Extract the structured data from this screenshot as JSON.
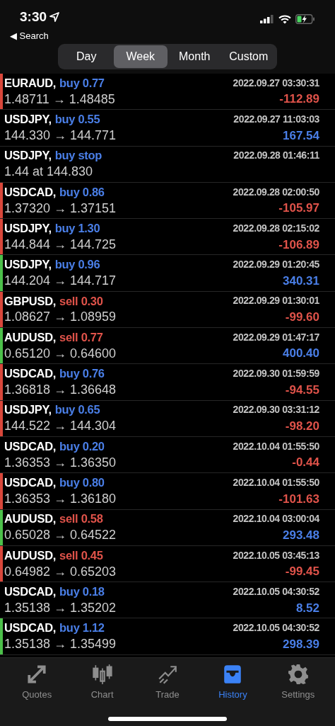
{
  "status_bar": {
    "time": "3:30",
    "back": "◀ Search"
  },
  "periods": [
    {
      "label": "Day",
      "selected": false
    },
    {
      "label": "Week",
      "selected": true
    },
    {
      "label": "Month",
      "selected": false
    },
    {
      "label": "Custom",
      "selected": false
    }
  ],
  "deals": [
    {
      "symbol": "EURAUD,",
      "order": {
        "text": "buy 0.77",
        "color": "#4a7fe8"
      },
      "prices": "1.48711 → 1.48485",
      "time": "2022.09.27 03:30:31",
      "profit": {
        "text": "-112.89",
        "color": "#e0534a"
      },
      "marker": {
        "color": "#d9473b"
      }
    },
    {
      "symbol": "USDJPY,",
      "order": {
        "text": "buy 0.55",
        "color": "#4a7fe8"
      },
      "prices": "144.330 → 144.771",
      "time": "2022.09.27 11:03:03",
      "profit": {
        "text": "167.54",
        "color": "#4a7fe8"
      }
    },
    {
      "symbol": "USDJPY,",
      "order": {
        "text": "buy stop",
        "color": "#4a7fe8"
      },
      "prices": "1.44 at 144.830",
      "time": "2022.09.28 01:46:11"
    },
    {
      "symbol": "USDCAD,",
      "order": {
        "text": "buy 0.86",
        "color": "#4a7fe8"
      },
      "prices": "1.37320 → 1.37151",
      "time": "2022.09.28 02:00:50",
      "profit": {
        "text": "-105.97",
        "color": "#e0534a"
      },
      "marker": {
        "color": "#d9473b"
      }
    },
    {
      "symbol": "USDJPY,",
      "order": {
        "text": "buy 1.30",
        "color": "#4a7fe8"
      },
      "prices": "144.844 → 144.725",
      "time": "2022.09.28 02:15:02",
      "profit": {
        "text": "-106.89",
        "color": "#e0534a"
      },
      "marker": {
        "color": "#d9473b"
      }
    },
    {
      "symbol": "USDJPY,",
      "order": {
        "text": "buy 0.96",
        "color": "#4a7fe8"
      },
      "prices": "144.204 → 144.717",
      "time": "2022.09.29 01:20:45",
      "profit": {
        "text": "340.31",
        "color": "#4a7fe8"
      },
      "marker": {
        "color": "#4cc04a"
      }
    },
    {
      "symbol": "GBPUSD,",
      "order": {
        "text": "sell 0.30",
        "color": "#e0534a"
      },
      "prices": "1.08627 → 1.08959",
      "time": "2022.09.29 01:30:01",
      "profit": {
        "text": "-99.60",
        "color": "#e0534a"
      },
      "marker": {
        "color": "#d9473b"
      }
    },
    {
      "symbol": "AUDUSD,",
      "order": {
        "text": "sell 0.77",
        "color": "#e0534a"
      },
      "prices": "0.65120 → 0.64600",
      "time": "2022.09.29 01:47:17",
      "profit": {
        "text": "400.40",
        "color": "#4a7fe8"
      },
      "marker": {
        "color": "#4cc04a"
      }
    },
    {
      "symbol": "USDCAD,",
      "order": {
        "text": "buy 0.76",
        "color": "#4a7fe8"
      },
      "prices": "1.36818 → 1.36648",
      "time": "2022.09.30 01:59:59",
      "profit": {
        "text": "-94.55",
        "color": "#e0534a"
      },
      "marker": {
        "color": "#d9473b"
      }
    },
    {
      "symbol": "USDJPY,",
      "order": {
        "text": "buy 0.65",
        "color": "#4a7fe8"
      },
      "prices": "144.522 → 144.304",
      "time": "2022.09.30 03:31:12",
      "profit": {
        "text": "-98.20",
        "color": "#e0534a"
      },
      "marker": {
        "color": "#d9473b"
      }
    },
    {
      "symbol": "USDCAD,",
      "order": {
        "text": "buy 0.20",
        "color": "#4a7fe8"
      },
      "prices": "1.36353 → 1.36350",
      "time": "2022.10.04 01:55:50",
      "profit": {
        "text": "-0.44",
        "color": "#e0534a"
      }
    },
    {
      "symbol": "USDCAD,",
      "order": {
        "text": "buy 0.80",
        "color": "#4a7fe8"
      },
      "prices": "1.36353 → 1.36180",
      "time": "2022.10.04 01:55:50",
      "profit": {
        "text": "-101.63",
        "color": "#e0534a"
      },
      "marker": {
        "color": "#d9473b"
      }
    },
    {
      "symbol": "AUDUSD,",
      "order": {
        "text": "sell 0.58",
        "color": "#e0534a"
      },
      "prices": "0.65028 → 0.64522",
      "time": "2022.10.04 03:00:04",
      "profit": {
        "text": "293.48",
        "color": "#4a7fe8"
      },
      "marker": {
        "color": "#4cc04a"
      }
    },
    {
      "symbol": "AUDUSD,",
      "order": {
        "text": "sell 0.45",
        "color": "#e0534a"
      },
      "prices": "0.64982 → 0.65203",
      "time": "2022.10.05 03:45:13",
      "profit": {
        "text": "-99.45",
        "color": "#e0534a"
      },
      "marker": {
        "color": "#d9473b"
      }
    },
    {
      "symbol": "USDCAD,",
      "order": {
        "text": "buy 0.18",
        "color": "#4a7fe8"
      },
      "prices": "1.35138 → 1.35202",
      "time": "2022.10.05 04:30:52",
      "profit": {
        "text": "8.52",
        "color": "#4a7fe8"
      }
    },
    {
      "symbol": "USDCAD,",
      "order": {
        "text": "buy 1.12",
        "color": "#4a7fe8"
      },
      "prices": "1.35138 → 1.35499",
      "time": "2022.10.05 04:30:52",
      "profit": {
        "text": "298.39",
        "color": "#4a7fe8"
      },
      "marker": {
        "color": "#4cc04a"
      }
    }
  ],
  "tab_bar": [
    {
      "kind": "quotes",
      "label": "Quotes",
      "selected": false
    },
    {
      "kind": "chart",
      "label": "Chart",
      "selected": false
    },
    {
      "kind": "trade",
      "label": "Trade",
      "selected": false
    },
    {
      "kind": "history",
      "label": "History",
      "selected": true
    },
    {
      "kind": "settings",
      "label": "Settings",
      "selected": false
    }
  ]
}
